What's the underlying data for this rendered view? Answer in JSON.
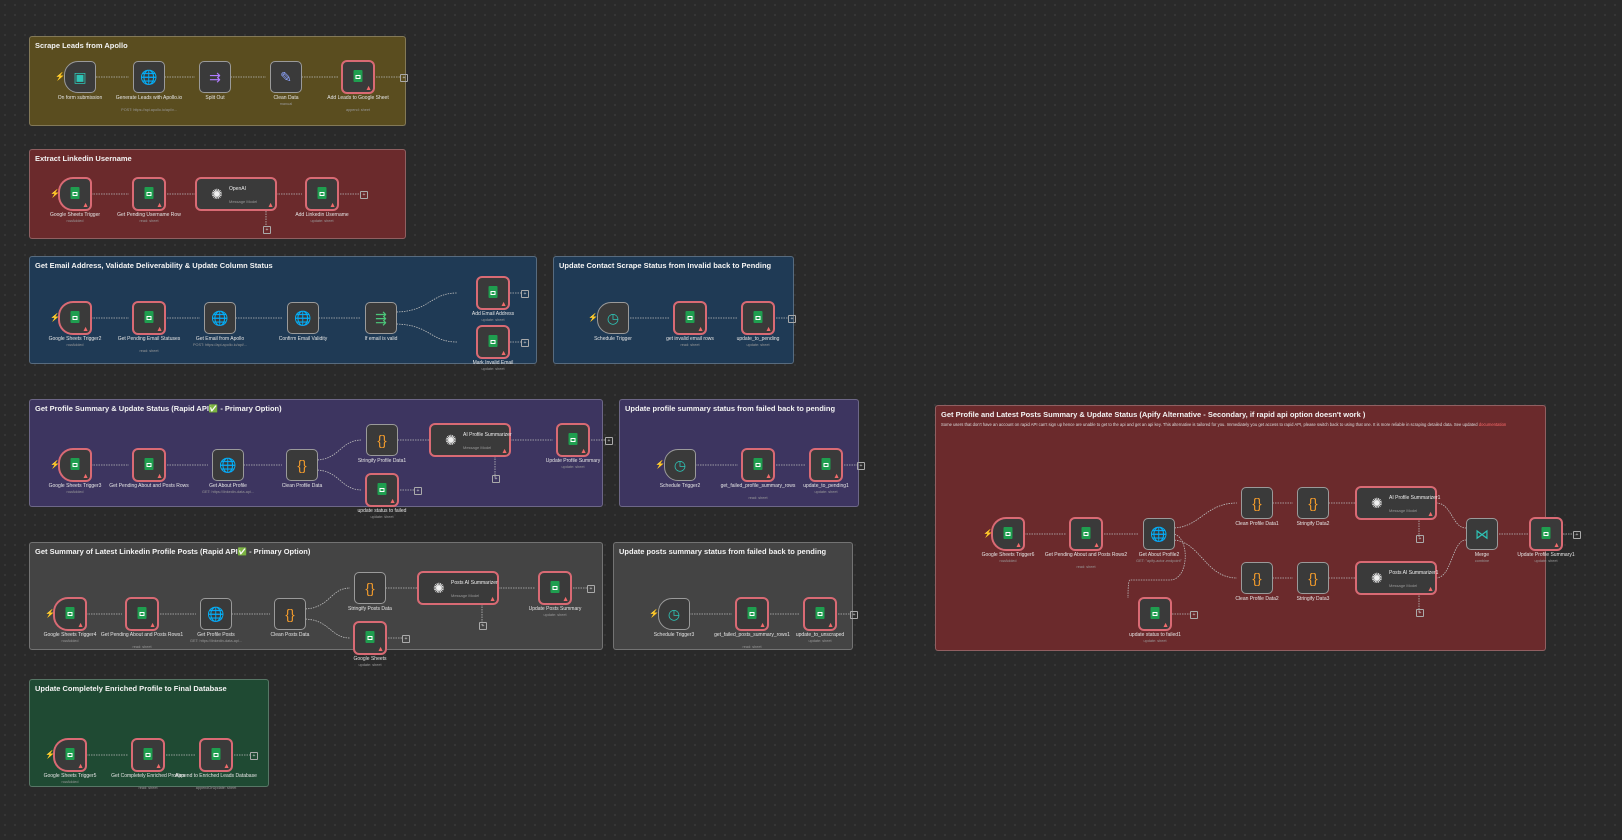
{
  "stickies": [
    {
      "id": "s1",
      "title": "Scrape Leads from Apollo",
      "color": "c-yellow"
    },
    {
      "id": "s2",
      "title": "Extract Linkedin Username",
      "color": "c-red"
    },
    {
      "id": "s3",
      "title": "Get Email Address, Validate Deliverability & Update Column Status",
      "color": "c-blue"
    },
    {
      "id": "s4",
      "title": "Update Contact Scrape Status from Invalid back to Pending",
      "color": "c-blue"
    },
    {
      "id": "s5",
      "title": "Get Profile Summary & Update Status (Rapid API✅ - Primary Option)",
      "color": "c-purple"
    },
    {
      "id": "s6",
      "title": "Update profile summary status from failed back to pending",
      "color": "c-purple"
    },
    {
      "id": "s7",
      "title": "Get Profile and Latest Posts Summary & Update Status (Apify Alternative - Secondary, if rapid api option doesn't work )",
      "color": "c-red",
      "desc": "Some users that don't have an account on rapid API can't sign up hence are unable to get to the api and get an api key. This alternative is tailored for you. Immediately you get access to rapid API, please switch back to using that one. It is more reliable in scraping detailed data. See updated ",
      "desc_link": "documentation"
    },
    {
      "id": "s8",
      "title": "Get Summary of Latest Linkedin Profile Posts (Rapid API✅ - Primary Option)",
      "color": "c-gray"
    },
    {
      "id": "s9",
      "title": "Update posts summary status from failed back to pending",
      "color": "c-gray"
    },
    {
      "id": "s10",
      "title": "Update Completely Enriched Profile to Final Database",
      "color": "c-green"
    }
  ],
  "nodes": [
    {
      "id": "n1",
      "label": "On form submission",
      "sub": "",
      "icon": "form-icon",
      "glyph": "▣",
      "glyphClass": "gl-teal",
      "trig": true,
      "err": false
    },
    {
      "id": "n2",
      "label": "Generate Leads with Apollo.io",
      "sub": "POST: https://api.apollo.io/api/v...",
      "icon": "globe-icon",
      "glyph": "🌐",
      "glyphClass": "gl-blue",
      "err": false
    },
    {
      "id": "n3",
      "label": "Split Out",
      "sub": "",
      "icon": "split-out-icon",
      "glyph": "⇉",
      "glyphClass": "gl-purple",
      "err": false
    },
    {
      "id": "n4",
      "label": "Clean Data",
      "sub": "manual",
      "icon": "pencil-icon",
      "glyph": "✎",
      "glyphClass": "gl-blue",
      "err": false
    },
    {
      "id": "n5",
      "label": "Add Leads to Google Sheet",
      "sub": "append: sheet",
      "icon": "sheets-icon",
      "sheet": true,
      "err": true
    },
    {
      "id": "n6",
      "label": "Google Sheets Trigger",
      "sub": "rowAdded",
      "icon": "sheets-icon",
      "sheet": true,
      "trig": true,
      "err": true
    },
    {
      "id": "n7",
      "label": "Get Pending Username Row",
      "sub": "read: sheet",
      "icon": "sheets-icon",
      "sheet": true,
      "err": true
    },
    {
      "id": "n8",
      "label": "OpenAI",
      "sub": "Message Model",
      "icon": "openai-icon",
      "glyph": "✺",
      "glyphClass": "gl-white",
      "wide": true,
      "err": true
    },
    {
      "id": "n9",
      "label": "Add Linkedin Username",
      "sub": "update: sheet",
      "icon": "sheets-icon",
      "sheet": true,
      "err": true
    },
    {
      "id": "n10",
      "label": "Google Sheets Trigger2",
      "sub": "rowAdded",
      "icon": "sheets-icon",
      "sheet": true,
      "trig": true,
      "err": true
    },
    {
      "id": "n11",
      "label": "Get Pending Email Statuses",
      "sub": "read: sheet",
      "icon": "sheets-icon",
      "sheet": true,
      "err": true
    },
    {
      "id": "n12",
      "label": "Get Email from Apollo",
      "sub": "POST: https://api.apollo.io/api/...",
      "icon": "globe-icon",
      "glyph": "🌐",
      "glyphClass": "gl-blue",
      "err": false
    },
    {
      "id": "n13",
      "label": "Confirm Email Validity",
      "sub": "",
      "icon": "globe-icon",
      "glyph": "🌐",
      "glyphClass": "gl-blue",
      "err": false
    },
    {
      "id": "n14",
      "label": "If email is valid",
      "sub": "",
      "icon": "if-icon",
      "glyph": "⇶",
      "glyphClass": "gl-green",
      "err": false
    },
    {
      "id": "n15",
      "label": "Add Email Address",
      "sub": "update: sheet",
      "icon": "sheets-icon",
      "sheet": true,
      "err": true
    },
    {
      "id": "n16",
      "label": "Mark Invalid Email",
      "sub": "update: sheet",
      "icon": "sheets-icon",
      "sheet": true,
      "err": true
    },
    {
      "id": "n17",
      "label": "Schedule Trigger",
      "sub": "",
      "icon": "clock-icon",
      "glyph": "◷",
      "glyphClass": "gl-teal",
      "trig": true,
      "err": false
    },
    {
      "id": "n18",
      "label": "get invalid email rows",
      "sub": "read: sheet",
      "icon": "sheets-icon",
      "sheet": true,
      "err": true
    },
    {
      "id": "n19",
      "label": "update_to_pending",
      "sub": "update: sheet",
      "icon": "sheets-icon",
      "sheet": true,
      "err": true
    },
    {
      "id": "n20",
      "label": "Google Sheets Trigger3",
      "sub": "rowAdded",
      "icon": "sheets-icon",
      "sheet": true,
      "trig": true,
      "err": true
    },
    {
      "id": "n21",
      "label": "Get Pending About and Posts Rows",
      "sub": "",
      "icon": "sheets-icon",
      "sheet": true,
      "err": true
    },
    {
      "id": "n22",
      "label": "Get About Profile",
      "sub": "GET: https://linkedin-data-api...",
      "icon": "globe-icon",
      "glyph": "🌐",
      "glyphClass": "gl-blue",
      "err": false
    },
    {
      "id": "n23",
      "label": "Clean Profile Data",
      "sub": "",
      "icon": "code-icon",
      "glyph": "{}",
      "glyphClass": "gl-orange",
      "err": false
    },
    {
      "id": "n24",
      "label": "Stringify Profile Data1",
      "sub": "",
      "icon": "code-icon",
      "glyph": "{}",
      "glyphClass": "gl-orange",
      "err": false
    },
    {
      "id": "n25",
      "label": "AI Profile Summarizer",
      "sub": "Message Model",
      "icon": "openai-icon",
      "glyph": "✺",
      "glyphClass": "gl-white",
      "wide": true,
      "err": true
    },
    {
      "id": "n26",
      "label": "Update Profile Summary",
      "sub": "update: sheet",
      "icon": "sheets-icon",
      "sheet": true,
      "err": true
    },
    {
      "id": "n27",
      "label": "update status to failed",
      "sub": "update: sheet",
      "icon": "sheets-icon",
      "sheet": true,
      "err": true
    },
    {
      "id": "n28",
      "label": "Schedule Trigger2",
      "sub": "",
      "icon": "clock-icon",
      "glyph": "◷",
      "glyphClass": "gl-teal",
      "trig": true,
      "err": false
    },
    {
      "id": "n29",
      "label": "get_failed_profile_summary_rows",
      "sub": "read: sheet",
      "icon": "sheets-icon",
      "sheet": true,
      "err": true
    },
    {
      "id": "n30",
      "label": "update_to_pending1",
      "sub": "update: sheet",
      "icon": "sheets-icon",
      "sheet": true,
      "err": true
    },
    {
      "id": "n31",
      "label": "Google Sheets Trigger4",
      "sub": "rowAdded",
      "icon": "sheets-icon",
      "sheet": true,
      "trig": true,
      "err": true
    },
    {
      "id": "n32",
      "label": "Get Pending About and Posts Rows1",
      "sub": "read: sheet",
      "icon": "sheets-icon",
      "sheet": true,
      "err": true
    },
    {
      "id": "n33",
      "label": "Get Profile Posts",
      "sub": "GET: https://linkedin-data-api...",
      "icon": "globe-icon",
      "glyph": "🌐",
      "glyphClass": "gl-blue",
      "err": false
    },
    {
      "id": "n34",
      "label": "Clean Posts Data",
      "sub": "",
      "icon": "code-icon",
      "glyph": "{}",
      "glyphClass": "gl-orange",
      "err": false
    },
    {
      "id": "n35",
      "label": "Stringify Posts Data",
      "sub": "",
      "icon": "code-icon",
      "glyph": "{}",
      "glyphClass": "gl-orange",
      "err": false
    },
    {
      "id": "n36",
      "label": "Posts AI Summarizer",
      "sub": "Message Model",
      "icon": "openai-icon",
      "glyph": "✺",
      "glyphClass": "gl-white",
      "wide": true,
      "err": true
    },
    {
      "id": "n37",
      "label": "Update Posts Summary",
      "sub": "update: sheet",
      "icon": "sheets-icon",
      "sheet": true,
      "err": true
    },
    {
      "id": "n38",
      "label": "Google Sheets",
      "sub": "update: sheet",
      "icon": "sheets-icon",
      "sheet": true,
      "err": true
    },
    {
      "id": "n39",
      "label": "Schedule Trigger3",
      "sub": "",
      "icon": "clock-icon",
      "glyph": "◷",
      "glyphClass": "gl-teal",
      "trig": true,
      "err": false
    },
    {
      "id": "n40",
      "label": "get_failed_posts_summary_rows1",
      "sub": "read: sheet",
      "icon": "sheets-icon",
      "sheet": true,
      "err": true
    },
    {
      "id": "n41",
      "label": "update_to_unscraped",
      "sub": "update: sheet",
      "icon": "sheets-icon",
      "sheet": true,
      "err": true
    },
    {
      "id": "n42",
      "label": "Google Sheets Trigger5",
      "sub": "rowAdded",
      "icon": "sheets-icon",
      "sheet": true,
      "trig": true,
      "err": true
    },
    {
      "id": "n43",
      "label": "Get Completely Enriched Profiles",
      "sub": "read: sheet",
      "icon": "sheets-icon",
      "sheet": true,
      "err": true
    },
    {
      "id": "n44",
      "label": "Append to Enriched Leads Database",
      "sub": "appendOrUpdate: sheet",
      "icon": "sheets-icon",
      "sheet": true,
      "err": true
    },
    {
      "id": "n45",
      "label": "Google Sheets Trigger6",
      "sub": "rowAdded",
      "icon": "sheets-icon",
      "sheet": true,
      "trig": true,
      "err": true
    },
    {
      "id": "n46",
      "label": "Get Pending About and Posts Rows2",
      "sub": "read: sheet",
      "icon": "sheets-icon",
      "sheet": true,
      "err": true
    },
    {
      "id": "n47",
      "label": "Get About Profile2",
      "sub": "GET: \"apify-actor-endpoint\"",
      "icon": "globe-icon",
      "glyph": "🌐",
      "glyphClass": "gl-blue",
      "err": false
    },
    {
      "id": "n48",
      "label": "Clean Profile Data1",
      "sub": "",
      "icon": "code-icon",
      "glyph": "{}",
      "glyphClass": "gl-orange",
      "err": false
    },
    {
      "id": "n49",
      "label": "Stringify Data2",
      "sub": "",
      "icon": "code-icon",
      "glyph": "{}",
      "glyphClass": "gl-orange",
      "err": false
    },
    {
      "id": "n50",
      "label": "AI Profile Summarizer1",
      "sub": "Message Model",
      "icon": "openai-icon",
      "glyph": "✺",
      "glyphClass": "gl-white",
      "wide": true,
      "err": true
    },
    {
      "id": "n51",
      "label": "Clean Profile Data2",
      "sub": "",
      "icon": "code-icon",
      "glyph": "{}",
      "glyphClass": "gl-orange",
      "err": false
    },
    {
      "id": "n52",
      "label": "Stringify Data3",
      "sub": "",
      "icon": "code-icon",
      "glyph": "{}",
      "glyphClass": "gl-orange",
      "err": false
    },
    {
      "id": "n53",
      "label": "Posts AI Summarizer1",
      "sub": "Message Model",
      "icon": "openai-icon",
      "glyph": "✺",
      "glyphClass": "gl-white",
      "wide": true,
      "err": true
    },
    {
      "id": "n54",
      "label": "Merge",
      "sub": "combine",
      "icon": "merge-icon",
      "glyph": "⋈",
      "glyphClass": "gl-teal",
      "err": false
    },
    {
      "id": "n55",
      "label": "Update Profile Summary1",
      "sub": "update: sheet",
      "icon": "sheets-icon",
      "sheet": true,
      "err": true
    },
    {
      "id": "n56",
      "label": "update status to failed1",
      "sub": "update: sheet",
      "icon": "sheets-icon",
      "sheet": true,
      "err": true
    }
  ]
}
